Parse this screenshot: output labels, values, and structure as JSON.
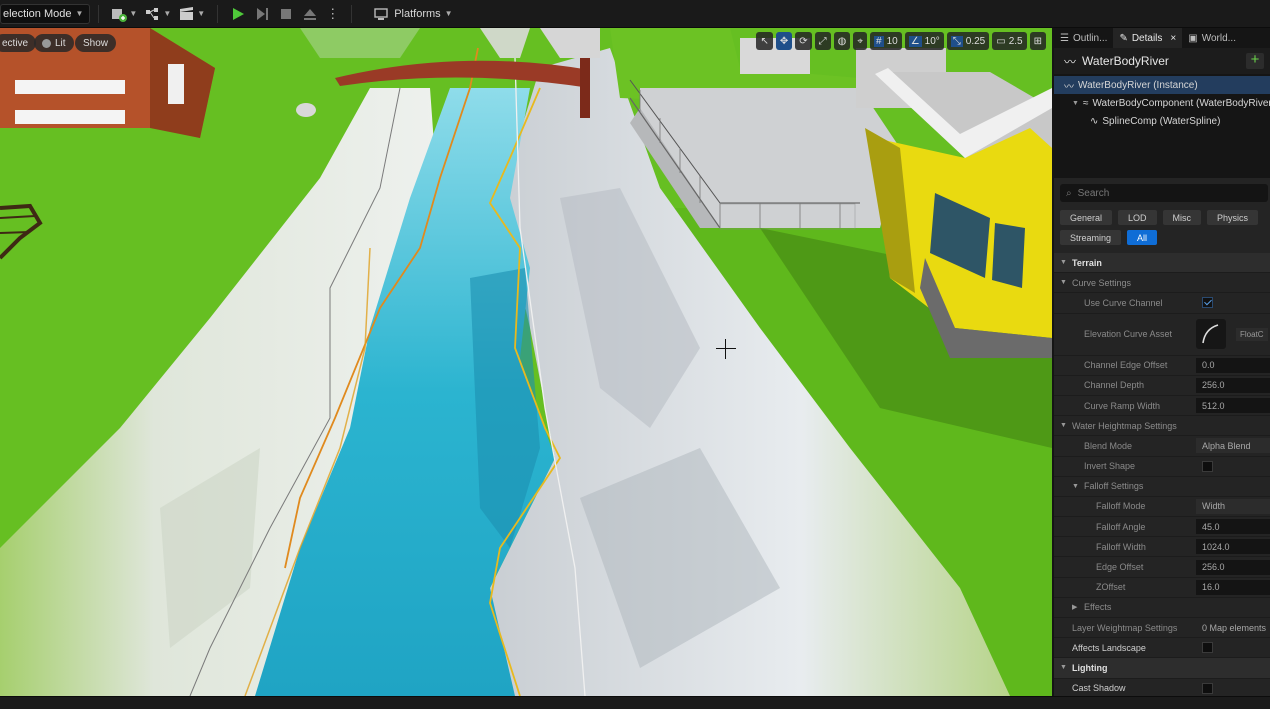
{
  "toolbar": {
    "mode_label": "election Mode",
    "platforms_label": "Platforms"
  },
  "viewport": {
    "perspective_label": "ective",
    "lit_label": "Lit",
    "show_label": "Show",
    "grid_snap_value": "10",
    "rotation_snap_value": "10°",
    "scale_snap_value": "0.25",
    "camera_speed_value": "2.5"
  },
  "panel": {
    "tabs": [
      {
        "label": "Outlin..."
      },
      {
        "label": "Details"
      },
      {
        "label": "World..."
      }
    ],
    "actor_name": "WaterBodyRiver",
    "tree": [
      {
        "label": "WaterBodyRiver (Instance)"
      },
      {
        "label": "WaterBodyComponent (WaterBodyRiver"
      },
      {
        "label": "SplineComp (WaterSpline)"
      }
    ],
    "search_placeholder": "Search",
    "filters": [
      "General",
      "LOD",
      "Misc",
      "Physics",
      "Streaming",
      "All"
    ],
    "categories": {
      "terrain": "Terrain",
      "curve_settings": "Curve Settings",
      "water_heightmap": "Water Heightmap Settings",
      "falloff": "Falloff Settings",
      "effects": "Effects",
      "lighting": "Lighting"
    },
    "props": {
      "use_curve_channel": "Use Curve Channel",
      "elevation_curve_asset": "Elevation Curve Asset",
      "curve_asset_name": "FloatC",
      "channel_edge_offset": {
        "label": "Channel Edge Offset",
        "value": "0.0"
      },
      "channel_depth": {
        "label": "Channel Depth",
        "value": "256.0"
      },
      "curve_ramp_width": {
        "label": "Curve Ramp Width",
        "value": "512.0"
      },
      "blend_mode": {
        "label": "Blend Mode",
        "value": "Alpha Blend"
      },
      "invert_shape": "Invert Shape",
      "falloff_mode": {
        "label": "Falloff Mode",
        "value": "Width"
      },
      "falloff_angle": {
        "label": "Falloff Angle",
        "value": "45.0"
      },
      "falloff_width": {
        "label": "Falloff Width",
        "value": "1024.0"
      },
      "edge_offset": {
        "label": "Edge Offset",
        "value": "256.0"
      },
      "zoffset": {
        "label": "ZOffset",
        "value": "16.0"
      },
      "layer_weightmap": {
        "label": "Layer Weightmap Settings",
        "value": "0 Map elements"
      },
      "affects_landscape": "Affects Landscape",
      "cast_shadow": "Cast Shadow"
    }
  }
}
